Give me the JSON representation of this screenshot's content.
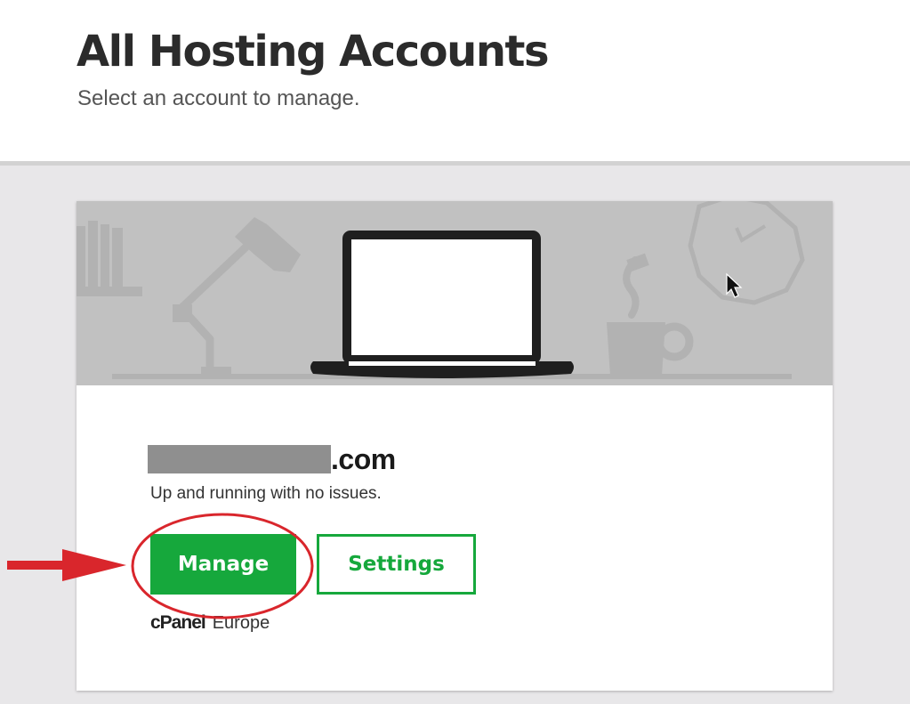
{
  "page": {
    "title": "All Hosting Accounts",
    "subtitle": "Select an account to manage."
  },
  "account": {
    "domain_tld": ".com",
    "status": "Up and running with no issues.",
    "actions": {
      "manage_label": "Manage",
      "settings_label": "Settings"
    },
    "control_panel": "cPanel",
    "region": "Europe"
  },
  "colors": {
    "brand_green": "#16a83c",
    "annotation_red": "#d9262c",
    "banner_bg": "#c1c1c1",
    "content_bg": "#e8e7e9"
  },
  "icons": [
    "laptop-illustration",
    "desk-lamp-illustration",
    "clock-illustration",
    "coffee-cup-illustration",
    "mouse-cursor-icon",
    "arrow-annotation"
  ]
}
